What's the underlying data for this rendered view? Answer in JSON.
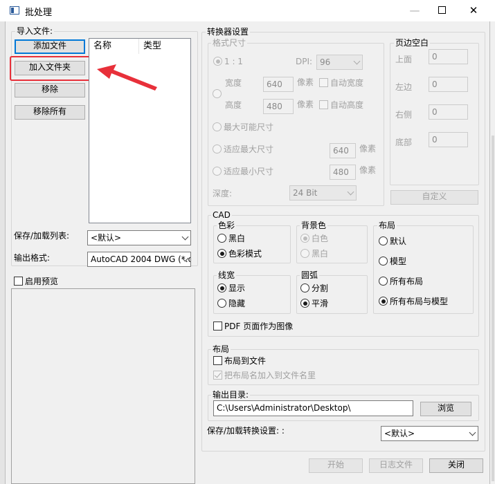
{
  "window": {
    "title": "批处理"
  },
  "import": {
    "group_label": "导入文件:",
    "add_file": "添加文件",
    "add_folder": "加入文件夹",
    "remove": "移除",
    "remove_all": "移除所有",
    "columns": [
      "名称",
      "类型"
    ],
    "save_load_list_label": "保存/加载列表:",
    "save_load_list_value": "<默认>",
    "output_format_label": "输出格式:",
    "output_format_value": "AutoCAD 2004 DWG (*.dwg)",
    "enable_preview": "启用预览"
  },
  "converter": {
    "group_label": "转换器设置",
    "format_size": {
      "label": "格式尺寸",
      "ratio": "1 : 1",
      "dpi_label": "DPI:",
      "dpi_value": "96",
      "width_label": "宽度",
      "width_value": "640",
      "height_label": "高度",
      "height_value": "480",
      "unit": "像素",
      "auto_width": "自动宽度",
      "auto_height": "自动高度",
      "max_possible": "最大可能尺寸",
      "fit_max": "适应最大尺寸",
      "fit_max_value": "640",
      "fit_min": "适应最小尺寸",
      "fit_min_value": "480",
      "depth_label": "深度:",
      "depth_value": "24 Bit"
    },
    "margins": {
      "label": "页边空白",
      "top_label": "上面",
      "top_value": "0",
      "left_label": "左边",
      "left_value": "0",
      "right_label": "右侧",
      "right_value": "0",
      "bottom_label": "底部",
      "bottom_value": "0",
      "custom_button": "自定义"
    },
    "cad": {
      "label": "CAD",
      "color": {
        "label": "色彩",
        "black_white": "黑白",
        "color_mode": "色彩模式"
      },
      "background": {
        "label": "背景色",
        "white": "白色",
        "black": "黑白"
      },
      "layout": {
        "label": "布局",
        "default": "默认",
        "model": "模型",
        "all_layouts": "所有布局",
        "all_layouts_model": "所有布局与模型"
      },
      "lineweight": {
        "label": "线宽",
        "show": "显示",
        "hide": "隐藏"
      },
      "arc": {
        "label": "圆弧",
        "split": "分割",
        "smooth": "平滑"
      },
      "pdf_as_image": "PDF 页面作为图像"
    },
    "layout_section": {
      "label": "布局",
      "layout_to_file": "布局到文件",
      "add_layout_name": "把布局名加入到文件名里"
    },
    "output_dir": {
      "label": "输出目录:",
      "value": "C:\\Users\\Administrator\\Desktop\\",
      "browse": "浏览"
    },
    "save_load_settings_label": "保存/加载转换设置: :",
    "save_load_settings_value": "<默认>"
  },
  "footer": {
    "start": "开始",
    "log": "日志文件",
    "close": "关闭"
  },
  "colors": {
    "annotation_red": "#e8303a",
    "focus_blue": "#0078d7"
  }
}
